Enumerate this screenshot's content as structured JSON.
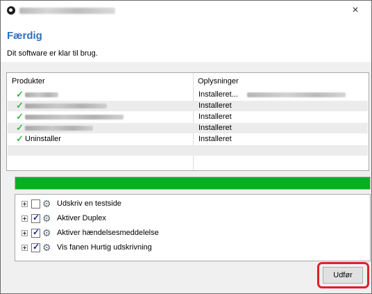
{
  "window": {
    "close_symbol": "×"
  },
  "header": {
    "title": "Færdig",
    "subtitle": "Dit software er klar til brug."
  },
  "product_table": {
    "columns": [
      "Produkter",
      "Oplysninger"
    ],
    "rows": [
      {
        "product": "",
        "info": "Installeret..."
      },
      {
        "product": "",
        "info": "Installeret"
      },
      {
        "product": "",
        "info": "Installeret"
      },
      {
        "product": "",
        "info": "Installeret"
      },
      {
        "product": "Uninstaller",
        "info": "Installeret"
      }
    ]
  },
  "progress": {
    "percent": 100,
    "color": "#06b025"
  },
  "options": [
    {
      "label": "Udskriv en testside",
      "checked": false
    },
    {
      "label": "Aktiver Duplex",
      "checked": true
    },
    {
      "label": "Aktiver hændelsesmeddelelse",
      "checked": true
    },
    {
      "label": "Vis fanen Hurtig udskrivning",
      "checked": true
    }
  ],
  "actions": {
    "execute_label": "Udfør",
    "highlight_color": "#e0202a"
  },
  "colors": {
    "title_blue": "#2d6fc0",
    "check_green": "#39b54a"
  }
}
